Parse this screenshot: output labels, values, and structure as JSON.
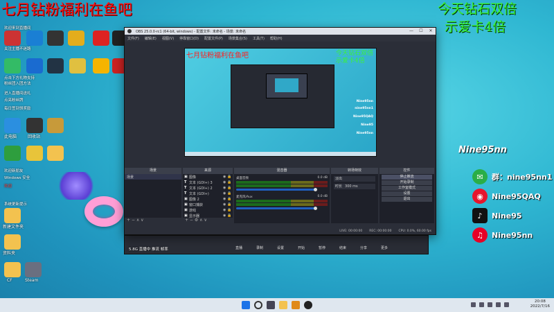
{
  "overlay": {
    "top_left_red": "七月钻粉福利在鱼吧",
    "top_right_line1": "今天钻石双倍",
    "top_right_line2": "示爱卡4倍"
  },
  "desktop": {
    "notice_lines": [
      "欢迎来到直播间",
      "关注主播不迷路",
      "点击下方礼物支持",
      "粉丝团入团方法",
      "进入直播间送礼",
      "点亮粉丝牌",
      "每日签到领奖励",
      "欢迎新朋友",
      "Windows 安全",
      "系统更新提示"
    ],
    "notice_red": "欢迎",
    "left_labels": [
      "此电脑",
      "回收站"
    ],
    "bottom_labels": [
      "新建文件夹",
      "资料夹",
      "CF",
      "Steam"
    ]
  },
  "obs": {
    "title": "OBS 25.0.0-rc1 (64-bit, windows) - 配置文件: 未命名 - 场景: 未命名",
    "win_min": "—",
    "win_max": "☐",
    "win_close": "✕",
    "menu": [
      "文件(F)",
      "编辑(E)",
      "视图(V)",
      "停靠窗口(D)",
      "配置文件(P)",
      "场景集合(S)",
      "工具(T)",
      "帮助(H)"
    ],
    "preview": {
      "red": "七月钻粉福利在鱼吧",
      "green_line1": "今天钻石双倍",
      "green_line2": "示爱卡4倍",
      "social": [
        "Nine95nn",
        "nine95nn1",
        "Nine95QAQ",
        "Nine95",
        "Nine95nn"
      ]
    },
    "docks": {
      "scenes": {
        "title": "场景",
        "items": [
          "场景"
        ],
        "footer": "+ − ∧ ∨"
      },
      "sources": {
        "title": "来源",
        "items": [
          {
            "type": "▣",
            "name": "图像"
          },
          {
            "type": "T",
            "name": "文本 (GDI+) 3"
          },
          {
            "type": "T",
            "name": "文本 (GDI+) 2"
          },
          {
            "type": "T",
            "name": "文本 (GDI+)"
          },
          {
            "type": "▣",
            "name": "图像 2"
          },
          {
            "type": "▣",
            "name": "窗口捕获"
          },
          {
            "type": "▣",
            "name": "游戏"
          },
          {
            "type": "▣",
            "name": "显示器"
          }
        ],
        "icons": "◉ 🔒",
        "footer": "+ − ⚙ ∧ ∨"
      },
      "mixer": {
        "title": "混音器",
        "tracks": [
          {
            "name": "桌面音频",
            "db": "0.0 dB"
          },
          {
            "name": "麦克风/Aux",
            "db": "0.0 dB"
          }
        ]
      },
      "transitions": {
        "title": "转场特效",
        "type": "淡出",
        "duration_label": "时长",
        "duration": "300 ms"
      },
      "controls": {
        "title": "控件",
        "buttons": [
          "停止推流",
          "开始录制",
          "工作室模式",
          "设置",
          "退出"
        ]
      }
    },
    "status": [
      "LIVE: 00:00:00",
      "REC: 00:00:00",
      "CPU: 0.0%, 60.00 fps"
    ]
  },
  "bg_window": {
    "items": [
      "直播",
      "录制",
      "设置",
      "开始",
      "暂停",
      "结束",
      "分享",
      "更多"
    ],
    "footer": "5.8G 直播中 推流 帧率"
  },
  "social_overlay": {
    "name": "Nine95nn",
    "rows": [
      {
        "icon_name": "wechat-icon",
        "label": "群：nine95nn1",
        "color": "#2aae47"
      },
      {
        "icon_name": "weibo-icon",
        "label": "Nine95QAQ",
        "color": "#e6162d"
      },
      {
        "icon_name": "douyin-icon",
        "label": "Nine95",
        "color": "#111111"
      },
      {
        "icon_name": "netease-music-icon",
        "label": "Nine95nn",
        "color": "#e60026"
      }
    ]
  },
  "taskbar": {
    "time": "20:08",
    "date": "2022/7/16"
  }
}
